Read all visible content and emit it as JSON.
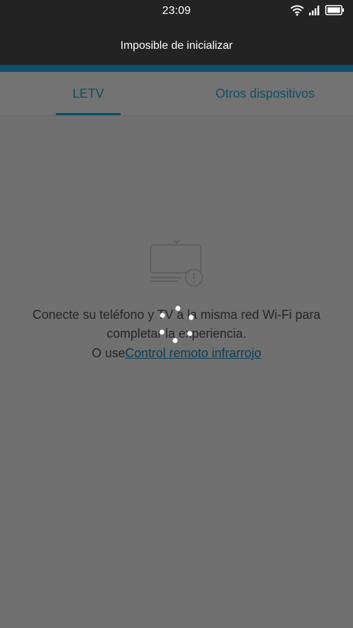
{
  "status_bar": {
    "time": "23:09",
    "icons": [
      "wifi-icon",
      "signal-icon",
      "battery-icon"
    ]
  },
  "header": {
    "title": "Imposible de inicializar"
  },
  "tabs": [
    {
      "label": "LETV",
      "active": true
    },
    {
      "label": "Otros dispositivos",
      "active": false
    }
  ],
  "main": {
    "message_line1": "Conecte su teléfono y TV a la misma red Wi-Fi para",
    "message_line2": "completar la experiencia.",
    "ir_prefix": "O use",
    "ir_link": "Control remoto infrarrojo"
  },
  "colors": {
    "status_bar_bg": "#232323",
    "accent": "#0d4e6b",
    "tab_text": "#0f4e66",
    "overlay_bg": "#707070",
    "link": "#0b3f58"
  }
}
